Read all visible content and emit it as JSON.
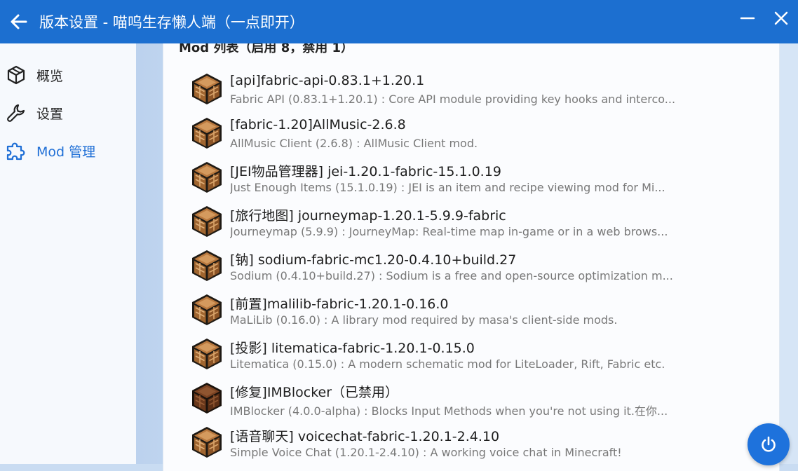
{
  "titlebar": {
    "title": "版本设置 - 喵呜生存懒人端（一点即开）"
  },
  "sidebar": {
    "items": [
      {
        "label": "概览",
        "icon": "cube-icon",
        "active": false
      },
      {
        "label": "设置",
        "icon": "wrench-icon",
        "active": false
      },
      {
        "label": "Mod 管理",
        "icon": "puzzle-icon",
        "active": true
      }
    ]
  },
  "mod_list": {
    "header": "Mod 列表（启用 8，禁用 1）",
    "items": [
      {
        "name": "[api]fabric-api-0.83.1+1.20.1",
        "desc": "Fabric API (0.83.1+1.20.1) : Core API module providing key hooks and interco...",
        "disabled": false
      },
      {
        "name": "[fabric-1.20]AllMusic-2.6.8",
        "desc": "AllMusic Client (2.6.8) : AllMusic Client mod.",
        "disabled": false
      },
      {
        "name": "[JEI物品管理器] jei-1.20.1-fabric-15.1.0.19",
        "desc": "Just Enough Items (15.1.0.19) : JEI is an item and recipe viewing mod for Mi...",
        "disabled": false
      },
      {
        "name": "[旅行地图] journeymap-1.20.1-5.9.9-fabric",
        "desc": "Journeymap (5.9.9) : JourneyMap: Real-time map in-game or in a web brows...",
        "disabled": false
      },
      {
        "name": "[钠] sodium-fabric-mc1.20-0.4.10+build.27",
        "desc": "Sodium (0.4.10+build.27) : Sodium is a free and open-source optimization m...",
        "disabled": false
      },
      {
        "name": "[前置]malilib-fabric-1.20.1-0.16.0",
        "desc": "MaLiLib (0.16.0) : A library mod required by masa's client-side mods.",
        "disabled": false
      },
      {
        "name": "[投影] litematica-fabric-1.20.1-0.15.0",
        "desc": "Litematica (0.15.0) : A modern schematic mod for LiteLoader, Rift, Fabric etc.",
        "disabled": false
      },
      {
        "name": "[修复]IMBlocker（已禁用）",
        "desc": "IMBlocker (4.0.0-alpha) : Blocks Input Methods when you're not using it.在你...",
        "disabled": true
      },
      {
        "name": "[语音聊天] voicechat-fabric-1.20.1-2.4.10",
        "desc": "Simple Voice Chat (1.20.1-2.4.10) : A working voice chat in Minecraft!",
        "disabled": false
      }
    ]
  },
  "icons": {
    "back": "arrow-left-icon",
    "minimize": "minimize-icon",
    "close": "close-icon",
    "mod": "crafting-table-icon",
    "launch": "power-icon"
  },
  "colors": {
    "titlebar": "#1c6fd0",
    "accent": "#1f6fd6",
    "mod_icon": "#b8783e",
    "mod_icon_disabled": "#7a4222"
  }
}
